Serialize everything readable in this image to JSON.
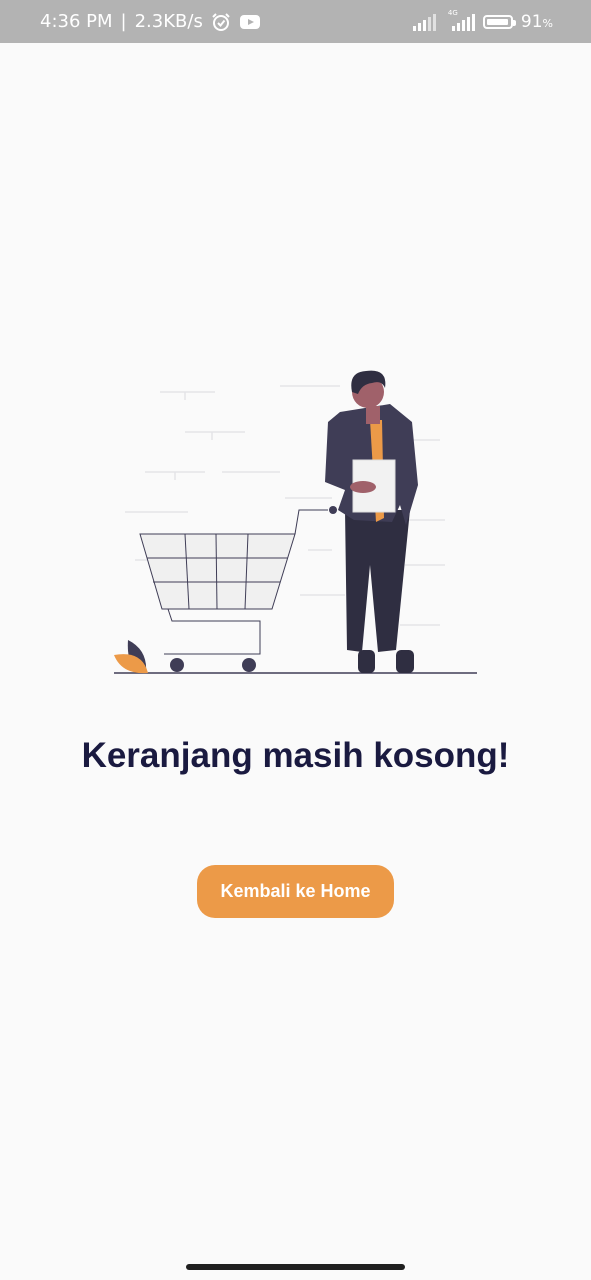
{
  "status_bar": {
    "time": "4:36 PM",
    "separator": "|",
    "network_speed": "2.3KB/s",
    "network_type": "4G",
    "battery_percent": "91",
    "battery_unit": "%",
    "icons": [
      "alarm-icon",
      "youtube-icon",
      "signal-icon",
      "signal-4g-icon",
      "battery-icon"
    ]
  },
  "empty_cart": {
    "title": "Keranjang masih kosong!",
    "button_label": "Kembali ke Home"
  },
  "colors": {
    "accent": "#ec9a48",
    "title": "#1a1a40",
    "background": "#fafafa",
    "status_bar": "#b3b3b3"
  }
}
